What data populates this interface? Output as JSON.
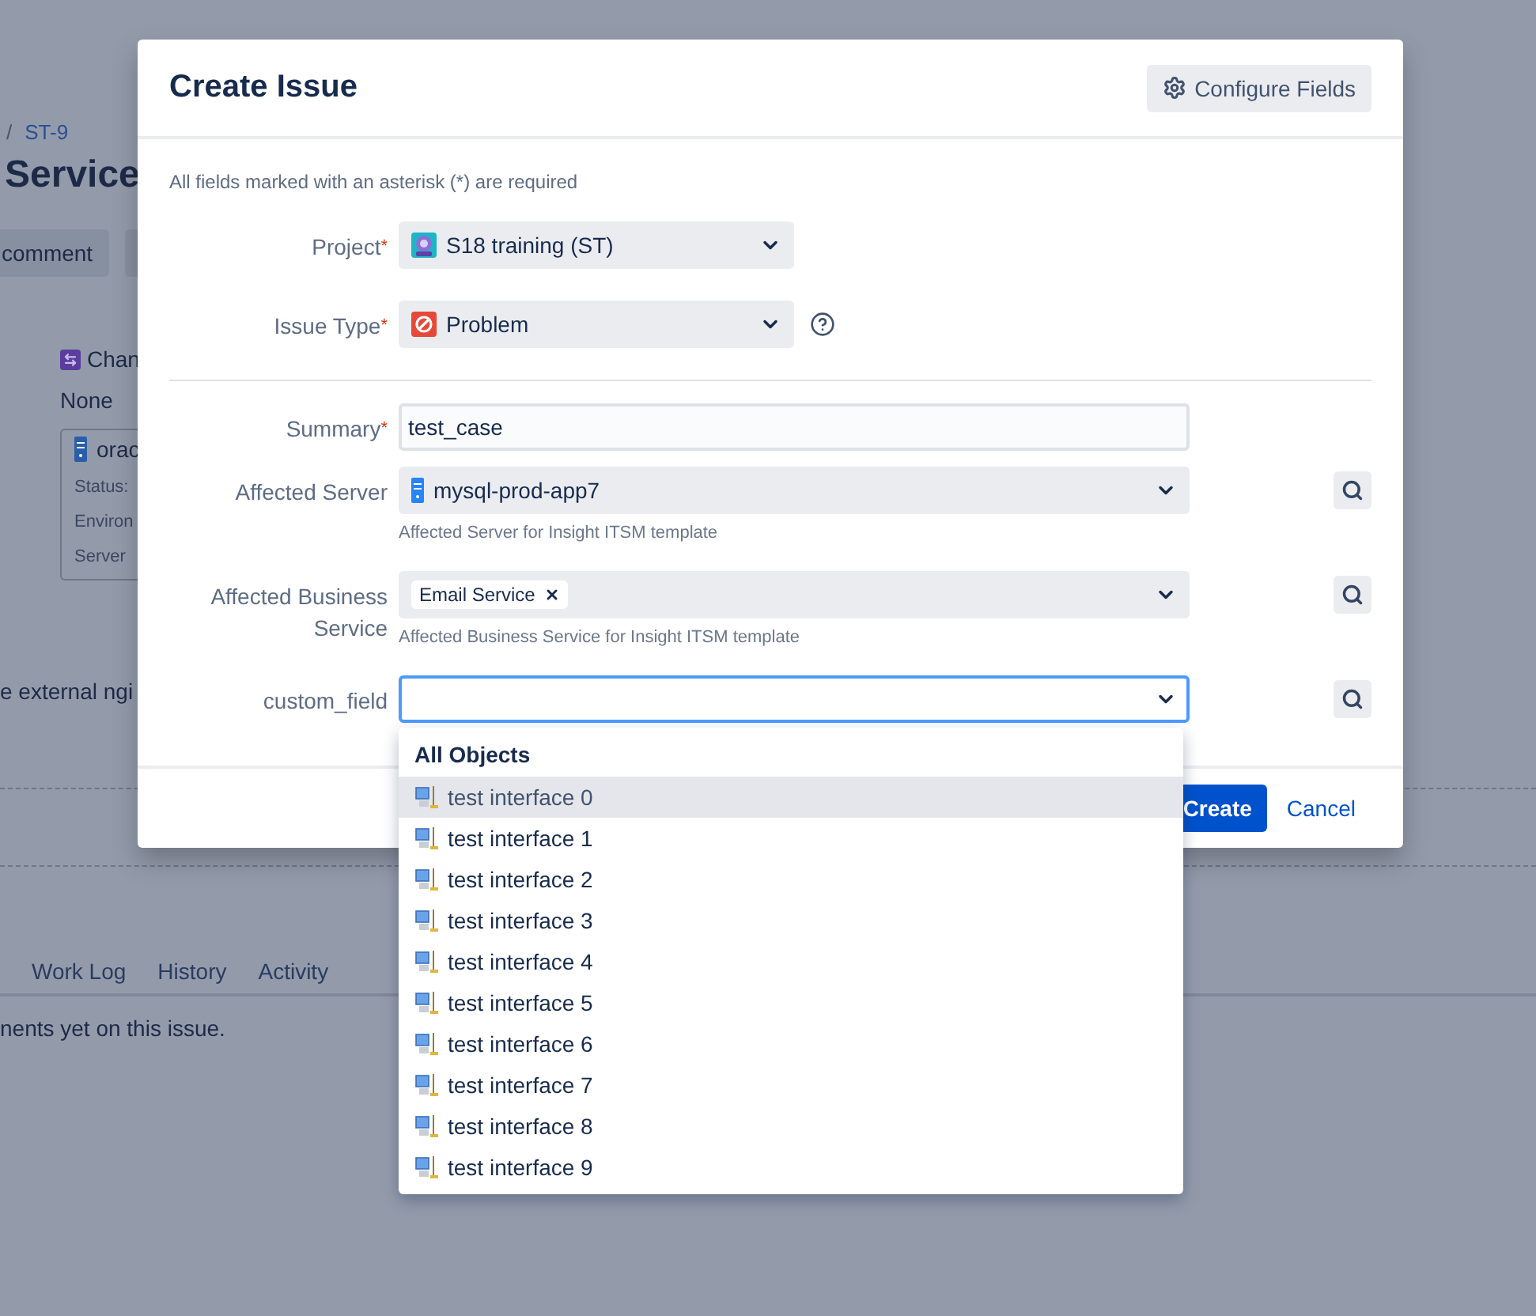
{
  "background_page": {
    "breadcrumb": {
      "separator": "/",
      "issue_key": "ST-9"
    },
    "title": "Service",
    "toolbar_buttons": [
      "comment"
    ],
    "change_label": "Chan",
    "change_value": "None",
    "object_card": {
      "name": "orac",
      "attributes": [
        "Status:",
        "Environ",
        "Server"
      ]
    },
    "description_fragment": "e external ngi",
    "tabs": [
      {
        "label": "Work Log",
        "selected": false
      },
      {
        "label": "History",
        "selected": false
      },
      {
        "label": "Activity",
        "selected": false
      }
    ],
    "comments_text": "nents yet on this issue."
  },
  "dialog": {
    "title": "Create Issue",
    "required_marker": "*",
    "configure_button": "Configure Fields",
    "required_note": "All fields marked with an asterisk (*) are required",
    "top_fields": [
      {
        "kind": "project",
        "label": "Project",
        "required": true,
        "value": "S18 training (ST)",
        "help": false
      },
      {
        "kind": "issue_type",
        "label": "Issue Type",
        "required": true,
        "value": "Problem",
        "help": true
      }
    ],
    "fields": [
      {
        "kind": "text",
        "label": "Summary",
        "required": true,
        "value": "test_case",
        "search": false
      },
      {
        "kind": "object",
        "label": "Affected Server",
        "required": false,
        "value": "mysql-prod-app7",
        "hint": "Affected Server for Insight ITSM template",
        "search": true
      },
      {
        "kind": "tags",
        "label": "Affected Business Service",
        "required": false,
        "tags": [
          "Email Service"
        ],
        "hint": "Affected Business Service for Insight ITSM template",
        "search": true
      },
      {
        "kind": "focused",
        "label": "custom_field",
        "required": false,
        "search": true
      }
    ],
    "create_button": "Create",
    "cancel_link": "Cancel",
    "dropdown": {
      "heading": "All Objects",
      "items": [
        {
          "label": "test interface 0",
          "selected": true
        },
        {
          "label": "test interface 1",
          "selected": false
        },
        {
          "label": "test interface 2",
          "selected": false
        },
        {
          "label": "test interface 3",
          "selected": false
        },
        {
          "label": "test interface 4",
          "selected": false
        },
        {
          "label": "test interface 5",
          "selected": false
        },
        {
          "label": "test interface 6",
          "selected": false
        },
        {
          "label": "test interface 7",
          "selected": false
        },
        {
          "label": "test interface 8",
          "selected": false
        },
        {
          "label": "test interface 9",
          "selected": false
        }
      ]
    }
  }
}
